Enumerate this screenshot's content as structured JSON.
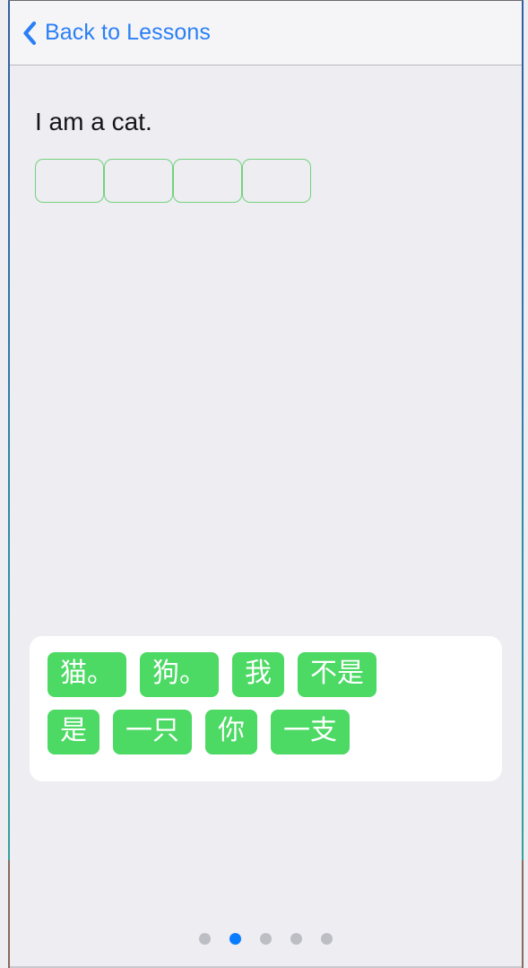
{
  "window": {
    "background_color": "#ededf2",
    "accent_color": "#2b7ff5",
    "tile_color": "#4cd964"
  },
  "navbar": {
    "back_icon": "chevron-left-icon",
    "back_label": "Back to Lessons"
  },
  "exercise": {
    "prompt": "I am a cat.",
    "answer_slots": [
      {
        "index": 1,
        "value": ""
      },
      {
        "index": 2,
        "value": ""
      },
      {
        "index": 3,
        "value": ""
      },
      {
        "index": 4,
        "value": ""
      }
    ],
    "word_bank": {
      "rows": [
        [
          {
            "label": "猫。"
          },
          {
            "label": "狗。"
          },
          {
            "label": "我"
          },
          {
            "label": "不是"
          }
        ],
        [
          {
            "label": "是"
          },
          {
            "label": "一只"
          },
          {
            "label": "你"
          },
          {
            "label": "一支"
          }
        ]
      ]
    }
  },
  "pager": {
    "total": 5,
    "active_index": 2,
    "active_color": "#0a7cff",
    "inactive_color": "#bdbdc4",
    "dots": [
      {
        "active": false
      },
      {
        "active": true
      },
      {
        "active": false
      },
      {
        "active": false
      },
      {
        "active": false
      }
    ]
  }
}
